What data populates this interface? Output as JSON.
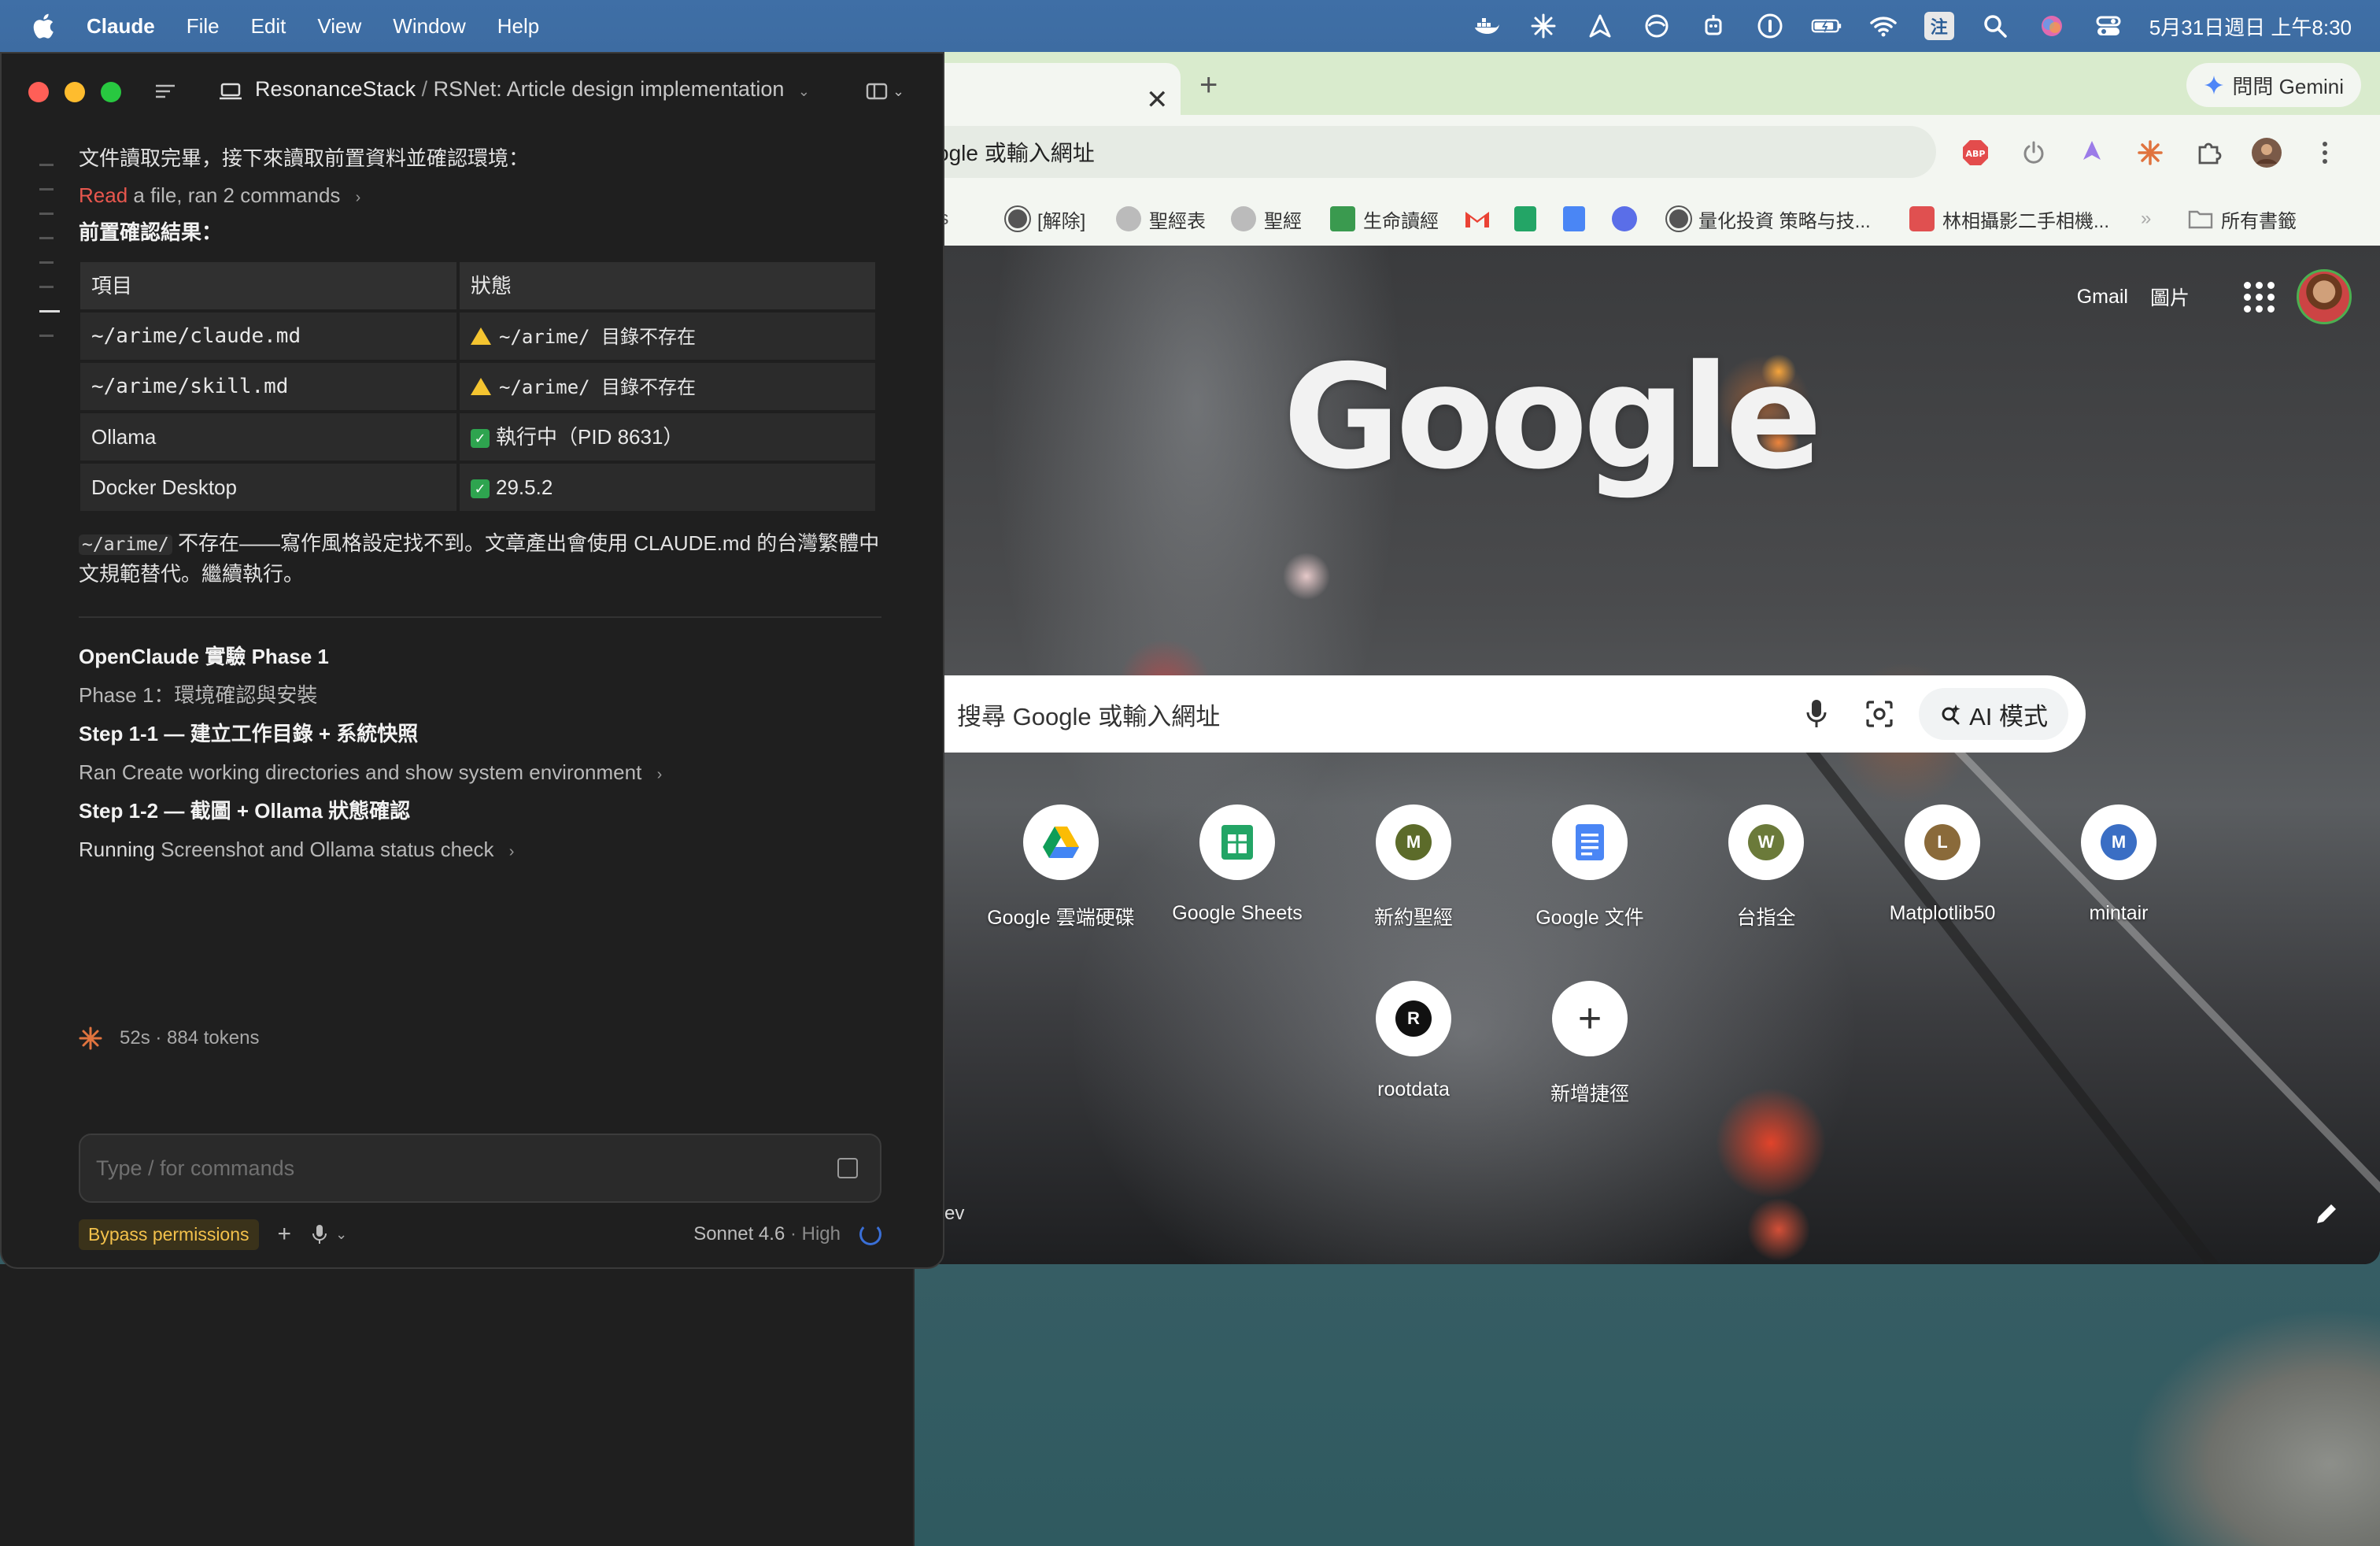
{
  "menubar": {
    "app_name": "Claude",
    "menus": [
      "File",
      "Edit",
      "View",
      "Window",
      "Help"
    ],
    "ime_badge": "注",
    "datetime": "5月31日週日 上午8:30"
  },
  "chrome": {
    "gemini_label": "問問 Gemini",
    "omnibox_text": "ogle 或輸入網址",
    "bookmarks": [
      {
        "label": "arks"
      },
      {
        "label": "[解除]"
      },
      {
        "label": "聖經表"
      },
      {
        "label": "聖經"
      },
      {
        "label": "生命讀經"
      },
      {
        "label": "量化投資 策略与技..."
      },
      {
        "label": "林相攝影二手相機..."
      },
      {
        "label": "所有書籤"
      }
    ],
    "ntp": {
      "links": [
        "Gmail",
        "圖片"
      ],
      "logo": "Google",
      "search_placeholder": "搜尋 Google 或輸入網址",
      "ai_mode_label": "AI 模式",
      "shortcuts": [
        {
          "label": "Google 雲端硬碟"
        },
        {
          "label": "Google Sheets"
        },
        {
          "label": "新約聖經",
          "letter": "M"
        },
        {
          "label": "Google 文件"
        },
        {
          "label": "台指全",
          "letter": "W"
        },
        {
          "label": "Matplotlib50",
          "letter": "L"
        },
        {
          "label": "mintair",
          "letter": "M"
        },
        {
          "label": "rootdata",
          "letter": "R"
        },
        {
          "label": "新增捷徑"
        }
      ],
      "edge_text": "ev"
    }
  },
  "claude": {
    "title_project": "ResonanceStack",
    "title_sep": "/",
    "title_session": "RSNet: Article design implementation",
    "intro": "文件讀取完畢，接下來讀取前置資料並確認環境：",
    "tool_summary": {
      "verb": "Read",
      "rest": "a file, ran 2 commands"
    },
    "section_title": "前置確認結果：",
    "table": {
      "headers": [
        "項目",
        "狀態"
      ],
      "rows": [
        {
          "item": "~/arime/claude.md",
          "status": "~/arime/ 目錄不存在"
        },
        {
          "item": "~/arime/skill.md",
          "status": "~/arime/ 目錄不存在"
        },
        {
          "item": "Ollama",
          "status": "執行中（PID 8631）"
        },
        {
          "item": "Docker Desktop",
          "status": "29.5.2"
        }
      ]
    },
    "note_code": "~/arime/",
    "note_text": "不存在——寫作風格設定找不到。文章產出會使用 CLAUDE.md 的台灣繁體中文規範替代。繼續執行。",
    "phase_title": "OpenClaude 實驗 Phase 1",
    "phase_sub": "Phase 1：環境確認與安裝",
    "step1_title": "Step 1-1 — 建立工作目錄 + 系統快照",
    "step1_run": "Ran Create working directories and show system environment",
    "step2_title": "Step 1-2 — 截圖 + Ollama 狀態確認",
    "step2_verb": "Running",
    "step2_run": "Screenshot and Ollama status check",
    "timer": "52s · 884 tokens",
    "composer_placeholder": "Type / for commands",
    "bypass_label": "Bypass permissions",
    "model_name": "Sonnet 4.6",
    "model_effort": "High",
    "model_sep": "·"
  }
}
